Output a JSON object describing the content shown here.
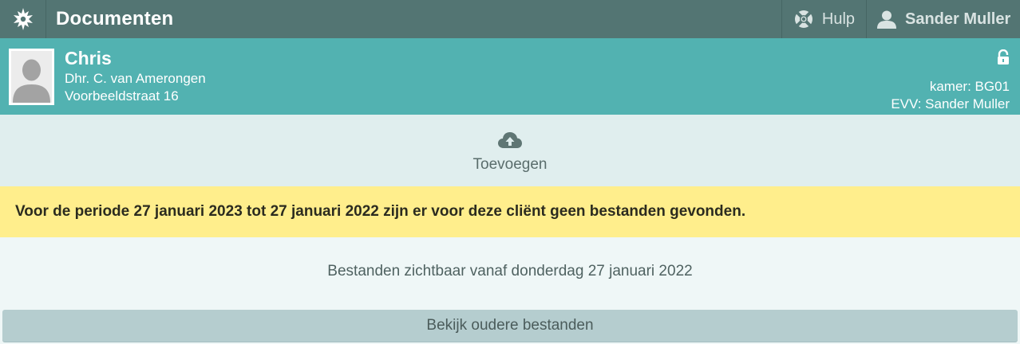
{
  "topbar": {
    "title": "Documenten",
    "help_label": "Hulp",
    "user_name": "Sander Muller"
  },
  "client": {
    "name": "Chris",
    "full_name": "Dhr. C. van Amerongen",
    "address": "Voorbeeldstraat 16",
    "room": "kamer: BG01",
    "evv": "EVV: Sander Muller"
  },
  "upload": {
    "label": "Toevoegen"
  },
  "warning": {
    "text": "Voor de periode 27 januari 2023 tot 27 januari 2022 zijn er voor deze cliënt geen bestanden gevonden."
  },
  "files": {
    "visible_from": "Bestanden zichtbaar vanaf donderdag 27 januari 2022",
    "older_button_label": "Bekijk oudere bestanden"
  },
  "icons": {
    "logo": "maple-leaf-logo-icon",
    "help": "lifebuoy-icon",
    "user": "user-icon",
    "lock": "lock-icon",
    "upload": "cloud-upload-icon",
    "avatar": "avatar-placeholder-icon"
  },
  "colors": {
    "topbar": "#537573",
    "client_header": "#52b2b1",
    "upload_area": "#e0eeee",
    "warning": "#ffee8c",
    "info_area": "#eff7f7",
    "older_button": "#b5cdcf"
  }
}
